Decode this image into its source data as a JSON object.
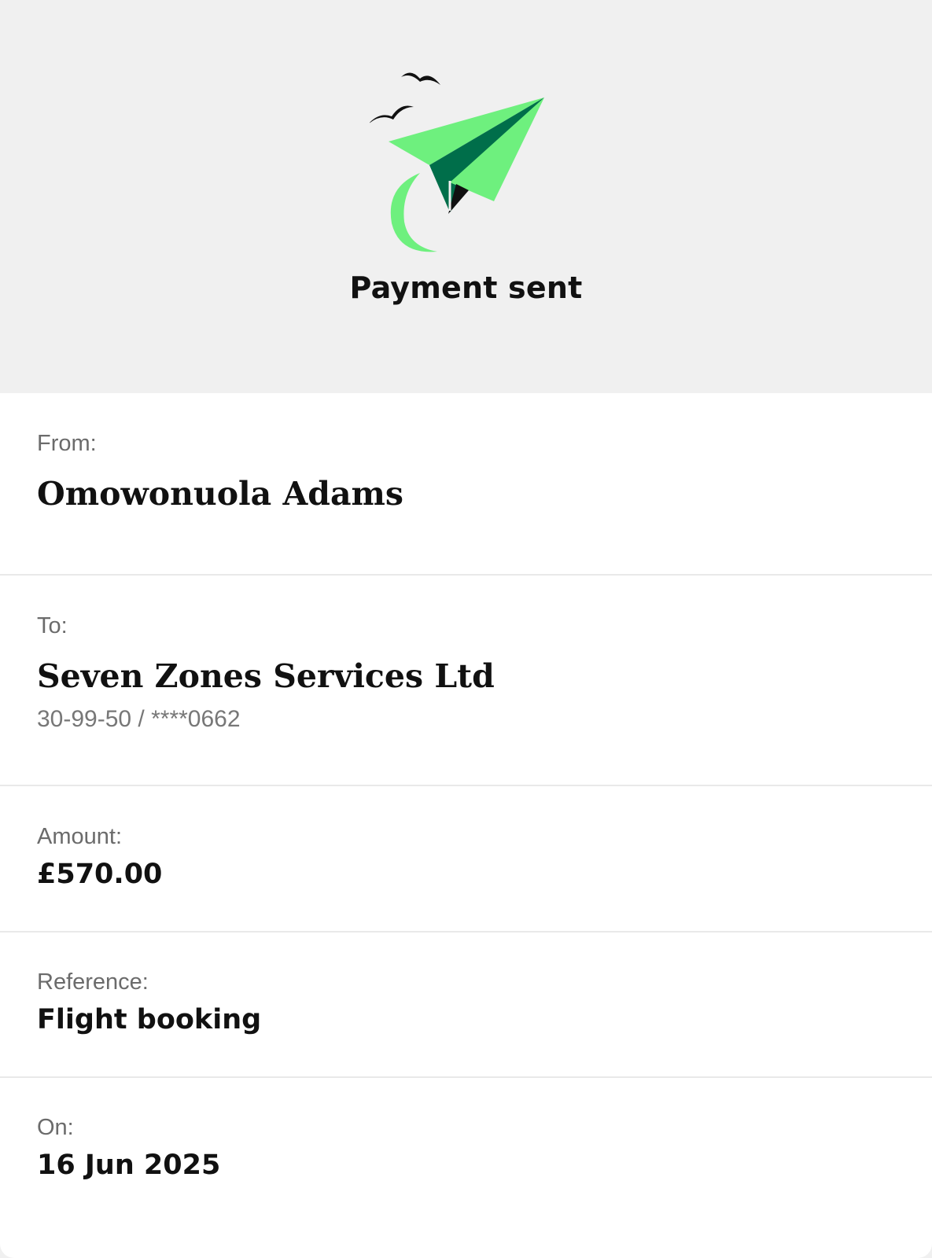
{
  "header": {
    "title": "Payment sent",
    "illustration": "paper-plane-with-birds-icon",
    "colors": {
      "plane_light": "#6ef07e",
      "plane_dark": "#006e4a",
      "birds": "#111111",
      "background": "#f0f0f0"
    }
  },
  "details": {
    "from": {
      "label": "From:",
      "value": "Omowonuola Adams"
    },
    "to": {
      "label": "To:",
      "value": "Seven Zones Services Ltd",
      "account": "30-99-50 / ****0662"
    },
    "amount": {
      "label": "Amount:",
      "value": "£570.00"
    },
    "reference": {
      "label": "Reference:",
      "value": "Flight booking"
    },
    "date": {
      "label": "On:",
      "value": "16 Jun 2025"
    }
  }
}
